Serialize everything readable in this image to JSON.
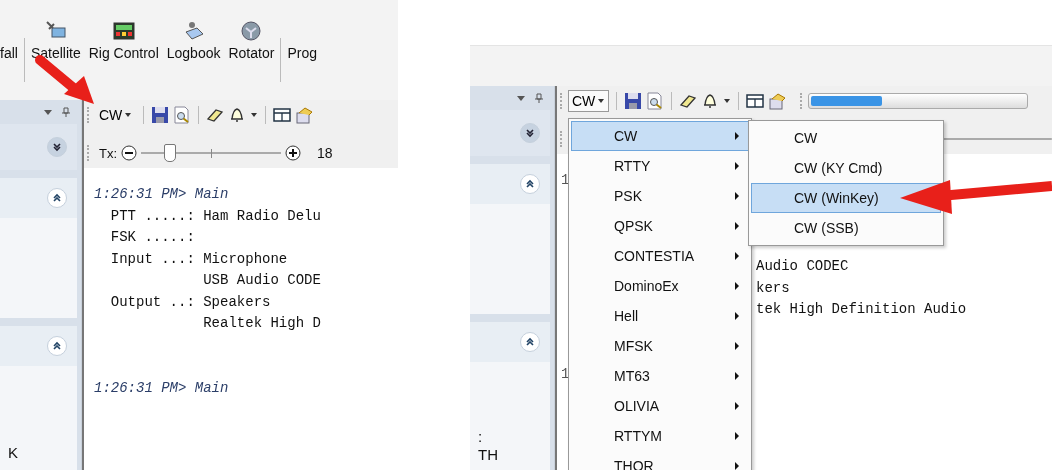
{
  "left_view": {
    "ribbon": [
      {
        "kind": "button",
        "label": "fall"
      },
      {
        "kind": "separator"
      },
      {
        "kind": "button",
        "label": "Satellite"
      },
      {
        "kind": "button",
        "label": "Rig Control"
      },
      {
        "kind": "button",
        "label": "Logbook"
      },
      {
        "kind": "button",
        "label": "Rotator"
      },
      {
        "kind": "separator"
      },
      {
        "kind": "button",
        "label": "Prog"
      }
    ],
    "mode_button": "CW",
    "tx_slider": {
      "label": "Tx:",
      "level": 0.2,
      "reading": "18"
    },
    "log": [
      {
        "kind": "header",
        "text": "1:26:31 PM> Main"
      },
      {
        "kind": "line",
        "text": "  PTT .....: Ham Radio Delu"
      },
      {
        "kind": "line",
        "text": "  FSK .....:"
      },
      {
        "kind": "line",
        "text": "  Input ...: Microphone"
      },
      {
        "kind": "line",
        "text": "             USB Audio CODE"
      },
      {
        "kind": "line",
        "text": "  Output ..: Speakers"
      },
      {
        "kind": "line",
        "text": "             Realtek High D"
      },
      {
        "kind": "blank"
      },
      {
        "kind": "blank"
      },
      {
        "kind": "header",
        "text": "1:26:31 PM> Main"
      }
    ],
    "sidebar_texts": [
      "K"
    ]
  },
  "right_view": {
    "mode_button": "CW",
    "progress": {
      "level": 0.33
    },
    "line_marks": [
      "1",
      "1"
    ],
    "log_fragments": [
      "Audio CODEC",
      "kers",
      "tek High Definition Audio"
    ],
    "sidebar_texts": [
      ":",
      "TH"
    ],
    "menu": [
      {
        "label": "CW",
        "selected": true
      },
      {
        "label": "RTTY",
        "selected": false
      },
      {
        "label": "PSK",
        "selected": false
      },
      {
        "label": "QPSK",
        "selected": false
      },
      {
        "label": "CONTESTIA",
        "selected": false
      },
      {
        "label": "DominoEx",
        "selected": false
      },
      {
        "label": "Hell",
        "selected": false
      },
      {
        "label": "MFSK",
        "selected": false
      },
      {
        "label": "MT63",
        "selected": false
      },
      {
        "label": "OLIVIA",
        "selected": false
      },
      {
        "label": "RTTYM",
        "selected": false
      },
      {
        "label": "THOR",
        "selected": false
      }
    ],
    "submenu": [
      {
        "label": "CW",
        "selected": false
      },
      {
        "label": "CW (KY Cmd)",
        "selected": false
      },
      {
        "label": "CW (WinKey)",
        "selected": true
      },
      {
        "label": "CW (SSB)",
        "selected": false
      }
    ]
  }
}
